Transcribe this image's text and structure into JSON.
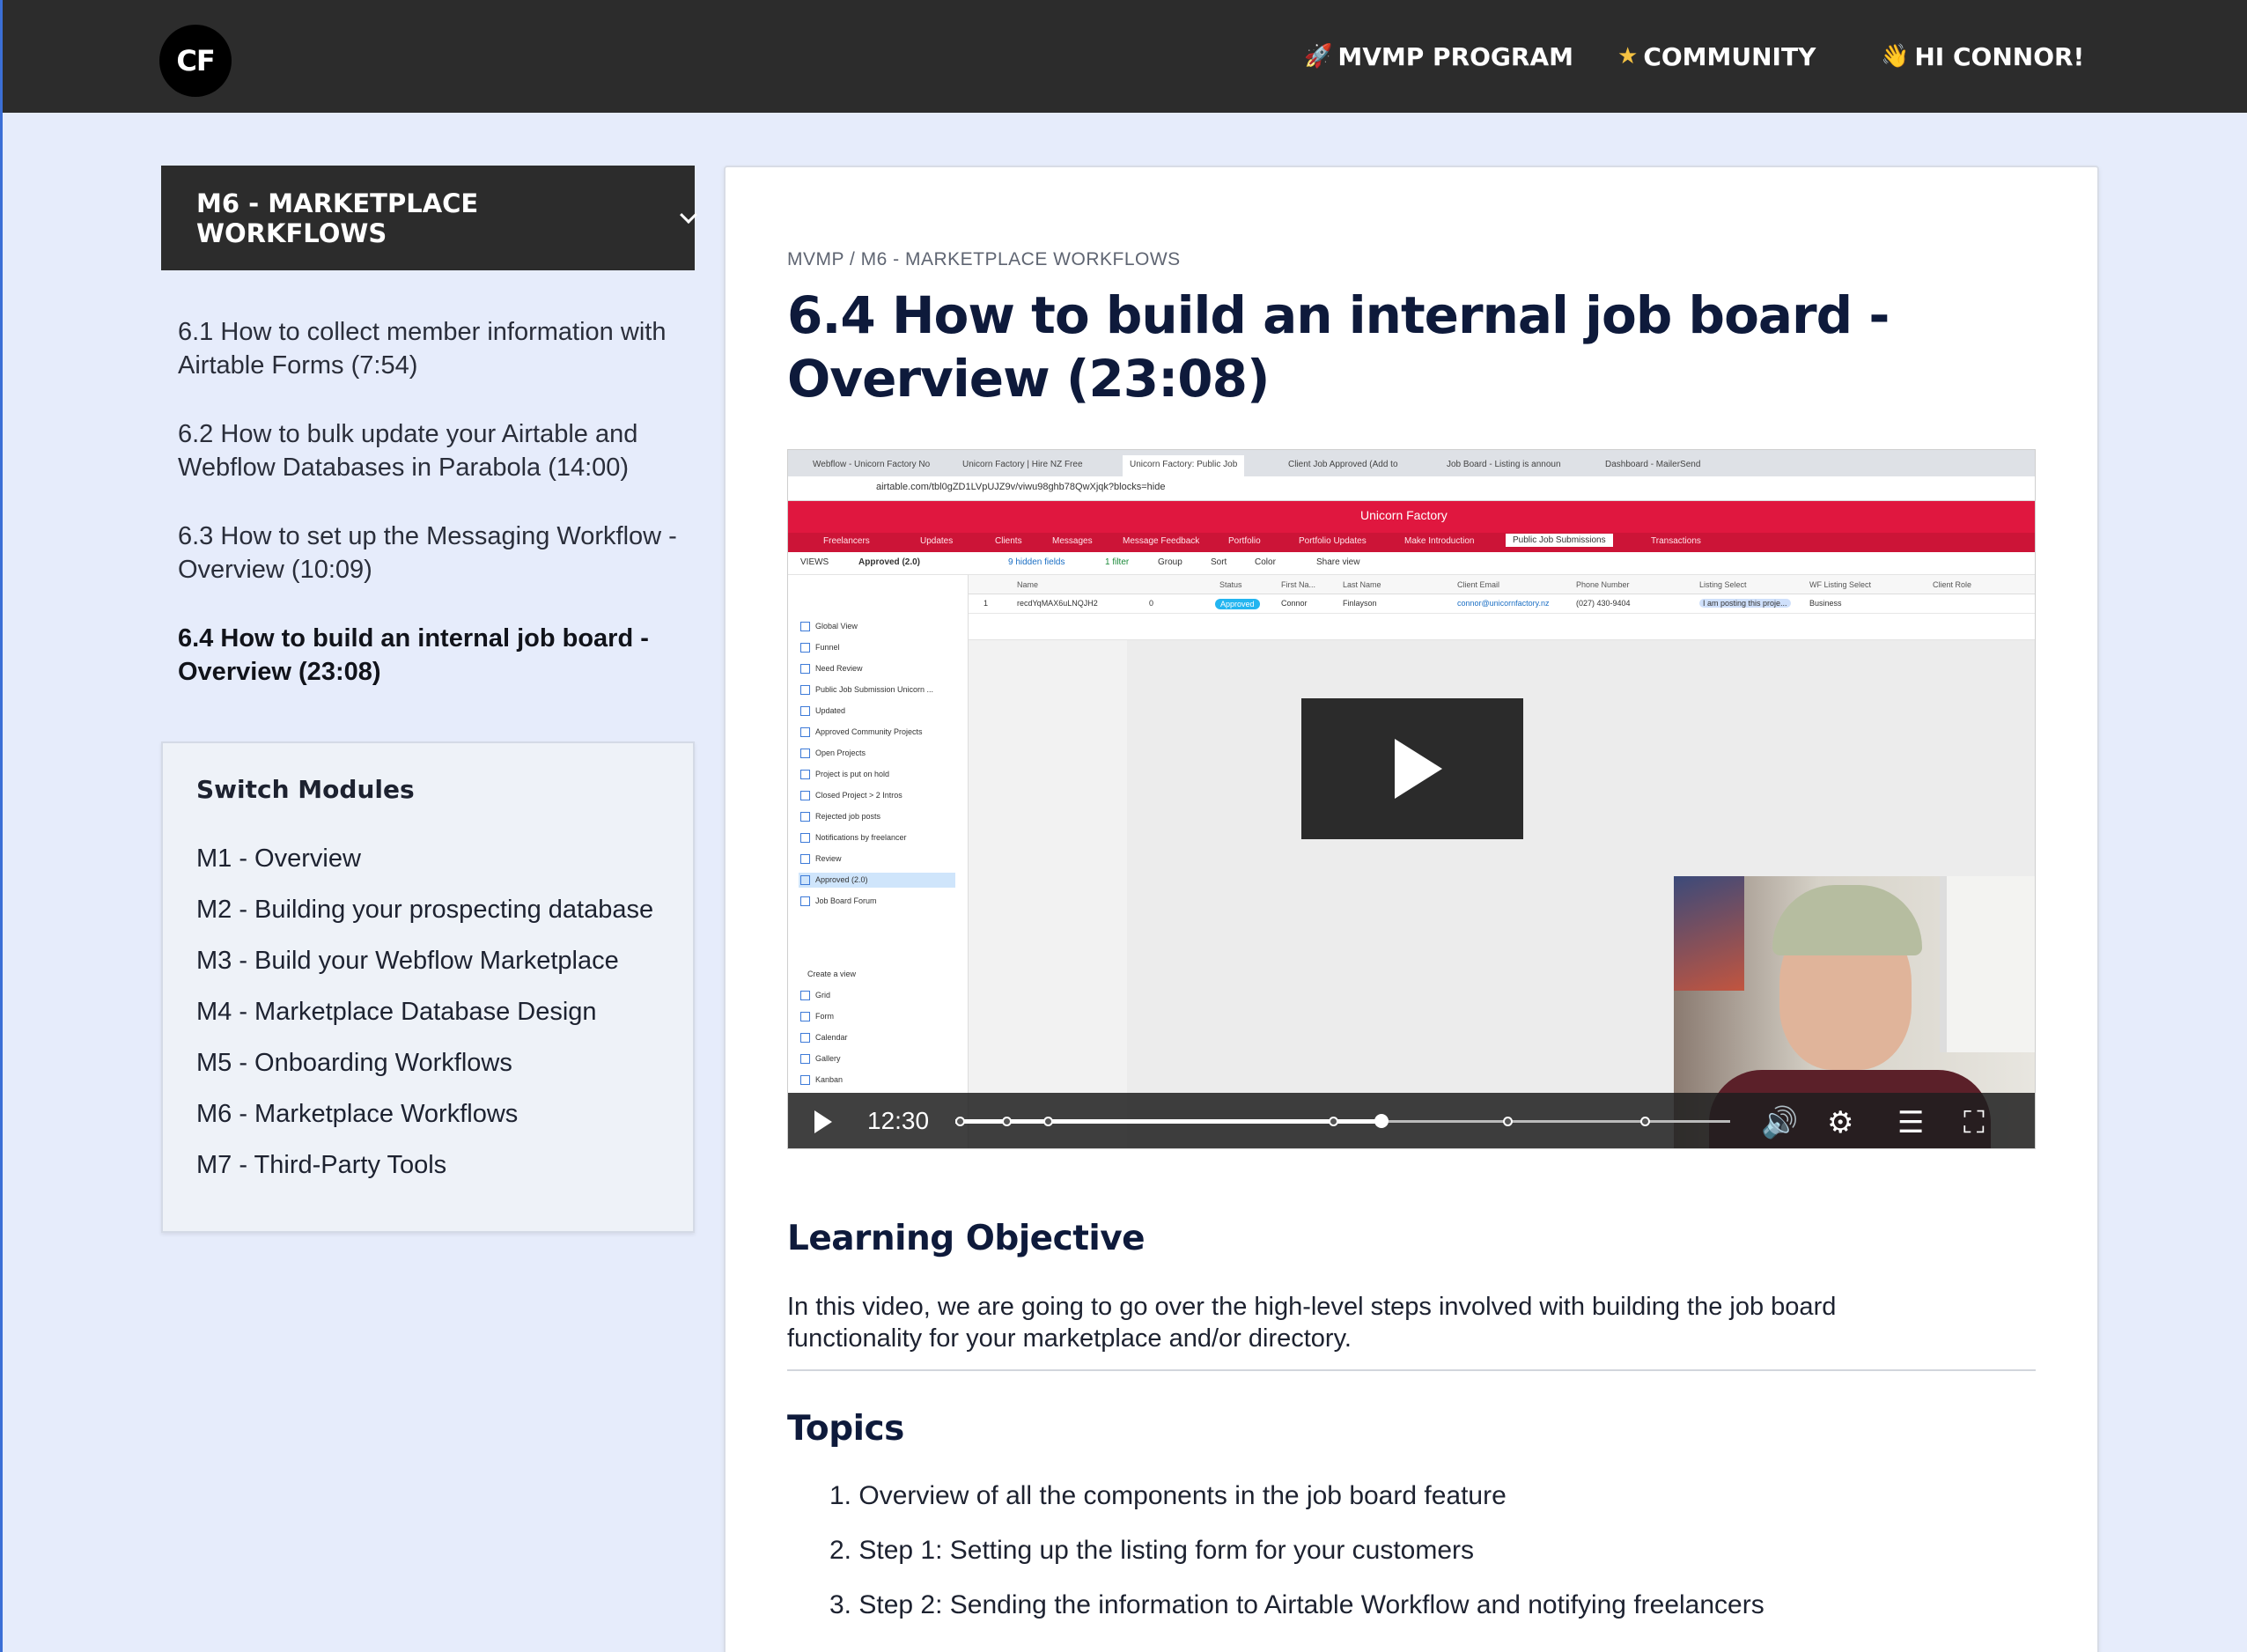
{
  "nav": {
    "logo": "CF",
    "mvmp": "MVMP PROGRAM",
    "community": "COMMUNITY",
    "greeting": "HI CONNOR!"
  },
  "sidebar": {
    "module_header": "M6 - MARKETPLACE WORKFLOWS",
    "lessons": [
      {
        "label": "6.1 How to collect member information with Airtable Forms (7:54)",
        "active": false
      },
      {
        "label": "6.2 How to bulk update your Airtable and Webflow Databases in Parabola (14:00)",
        "active": false
      },
      {
        "label": "6.3 How to set up the Messaging Workflow - Overview (10:09)",
        "active": false
      },
      {
        "label": "6.4 How to build an internal job board - Overview (23:08)",
        "active": true
      }
    ],
    "switch_title": "Switch Modules",
    "modules": [
      "M1 - Overview",
      "M2 - Building your prospecting database",
      "M3 - Build your Webflow Marketplace",
      "M4 - Marketplace Database Design",
      "M5 - Onboarding Workflows",
      "M6 - Marketplace Workflows",
      "M7 - Third-Party Tools"
    ]
  },
  "main": {
    "breadcrumb": "MVMP /  M6 - MARKETPLACE WORKFLOWS",
    "title": "6.4 How to build an internal job board - Overview (23:08)",
    "video": {
      "current_time": "12:30",
      "progress": 0.55,
      "inner": {
        "tabs": [
          "Webflow - Unicorn Factory No",
          "Unicorn Factory | Hire NZ Free",
          "Unicorn Factory: Public Job",
          "Client Job Approved (Add to",
          "Job Board - Listing is announ",
          "Dashboard - MailerSend"
        ],
        "url": "airtable.com/tbl0gZD1LVpUJZ9v/viwu98ghb78QwXjqk?blocks=hide",
        "app_title": "Unicorn Factory",
        "menus": [
          "Freelancers",
          "Updates",
          "Clients",
          "Messages",
          "Message Feedback",
          "Portfolio",
          "Portfolio Updates",
          "Make Introduction",
          "Public Job Submissions",
          "Transactions"
        ],
        "tools": [
          "VIEWS",
          "Approved (2.0)",
          "9 hidden fields",
          "1 filter",
          "Group",
          "Sort",
          "Color",
          "Share view"
        ],
        "views": [
          "Global View",
          "Funnel",
          "Need Review",
          "Public Job Submission Unicorn ...",
          "Updated",
          "Approved Community Projects",
          "Open Projects",
          "Project is put on hold",
          "Closed Project > 2 Intros",
          "Rejected job posts",
          "Notifications by freelancer",
          "Review",
          "Approved (2.0)",
          "Job Board Forum"
        ],
        "create_view": [
          "Create a view",
          "Grid",
          "Form",
          "Calendar",
          "Gallery",
          "Kanban"
        ],
        "columns": [
          "Name",
          "Status",
          "First Na...",
          "Last Name",
          "Client Email",
          "Phone Number",
          "Listing Select",
          "WF Listing Select",
          "Client Role"
        ],
        "row": {
          "id": "1",
          "name": "recdYqMAX6uLNQJH2",
          "zero": "0",
          "status": "Approved",
          "first": "Connor",
          "last": "Finlayson",
          "email": "connor@unicornfactory.nz",
          "phone": "(027) 430-9404",
          "listing": "I am posting this proje...",
          "role": "Business"
        }
      }
    },
    "objective_heading": "Learning Objective",
    "objective_text": "In this video, we are going to go over the high-level steps involved with building the job board functionality for your marketplace and/or directory.",
    "topics_heading": "Topics",
    "topics": [
      "1. Overview of all the components in the job board feature",
      "2. Step 1: Setting up the listing form for your customers",
      "3. Step 2: Sending the information to Airtable Workflow and notifying freelancers"
    ]
  }
}
